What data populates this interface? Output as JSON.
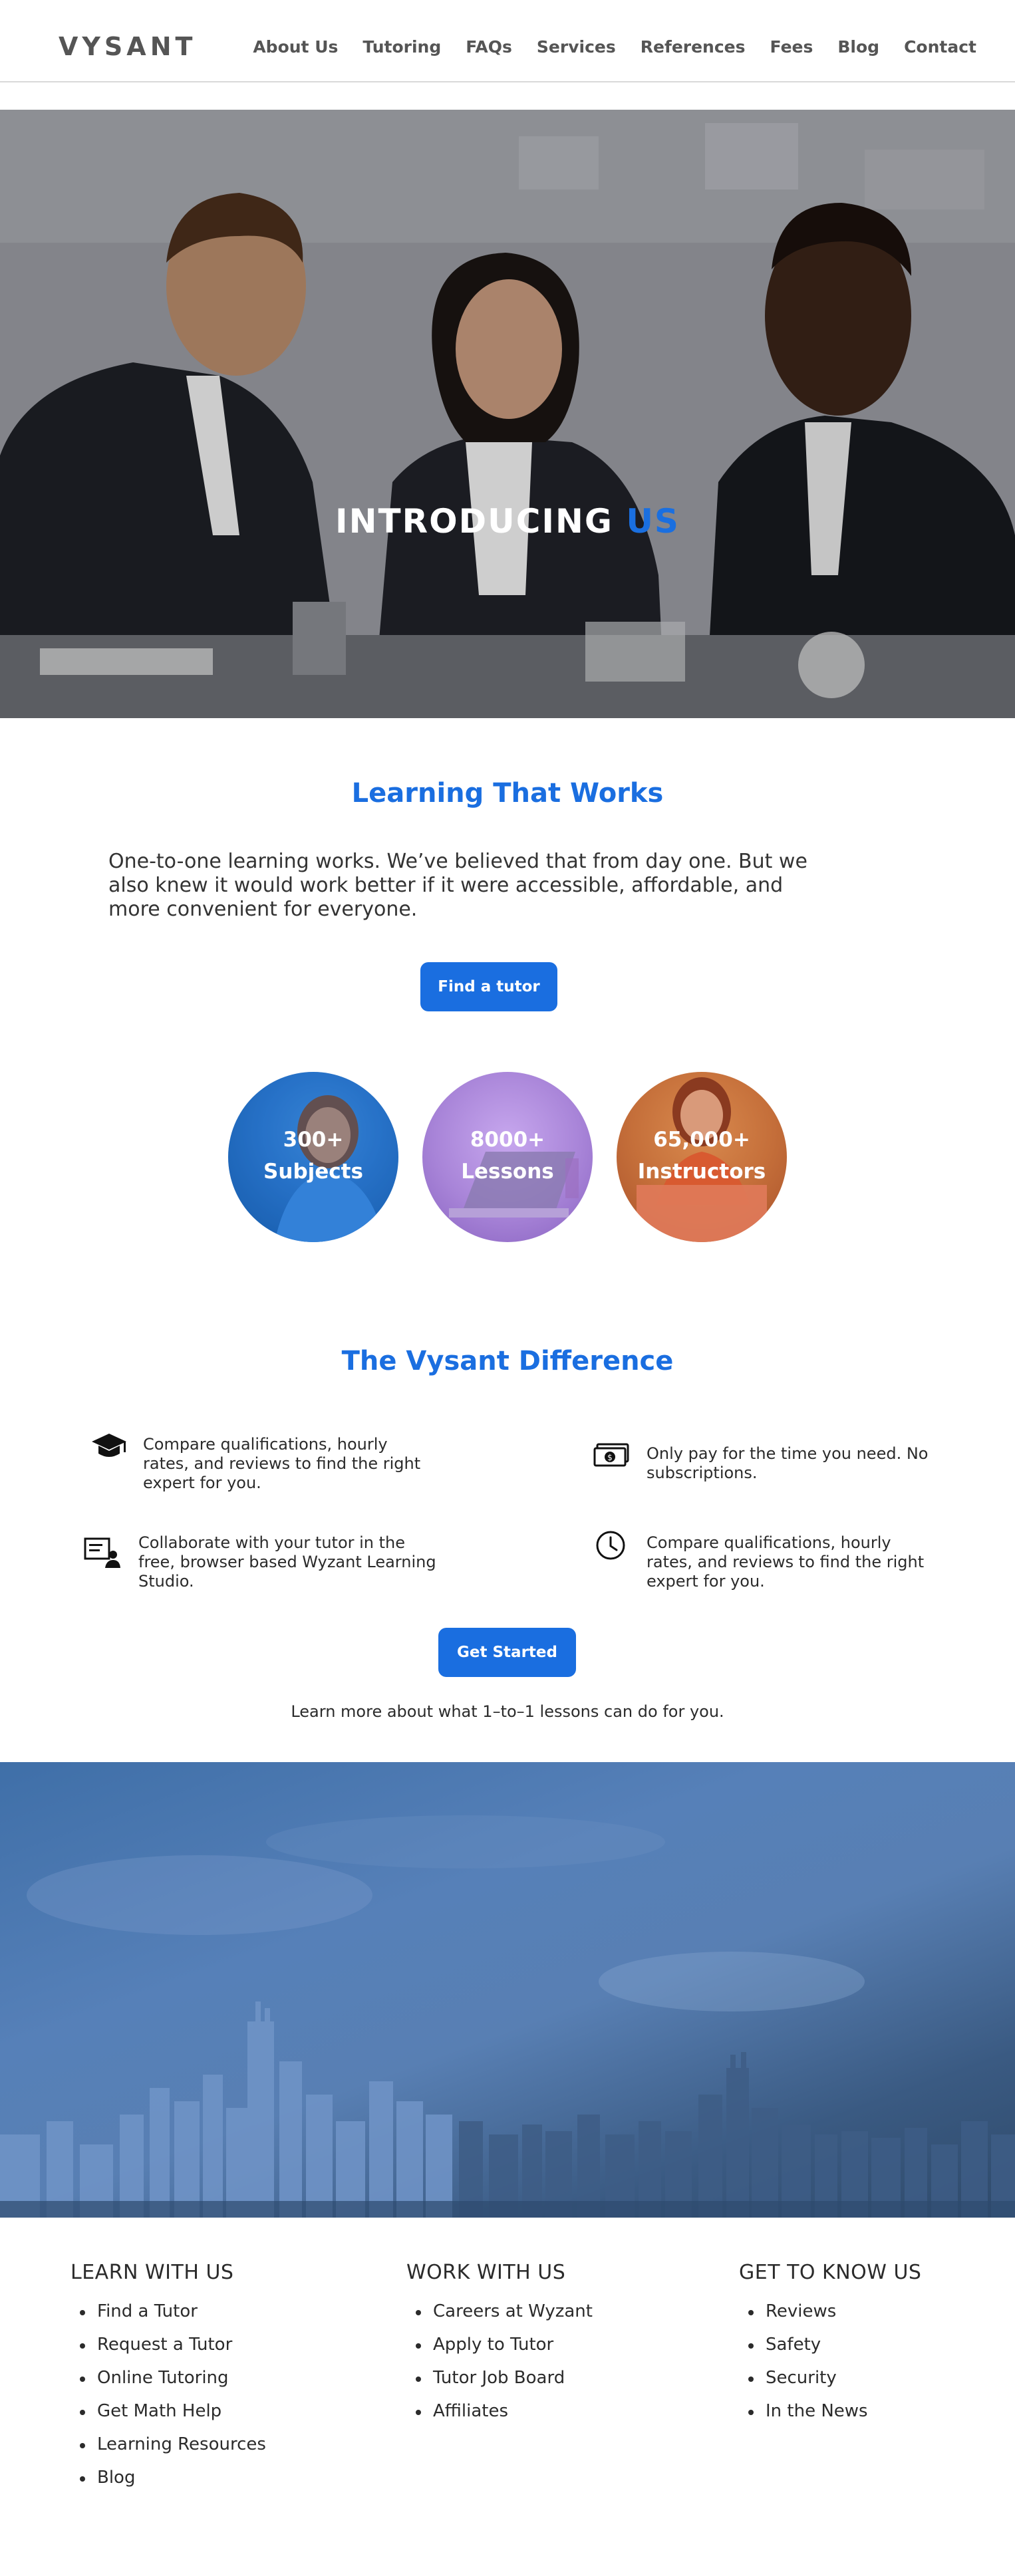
{
  "header": {
    "logo": "VYSANT",
    "nav": [
      "About Us",
      "Tutoring",
      "FAQs",
      "Services",
      "References",
      "Fees",
      "Blog",
      "Contact"
    ]
  },
  "hero": {
    "title_main": "INTRODUCING ",
    "title_accent": "US"
  },
  "learning": {
    "title": "Learning That Works",
    "text": "One-to-one learning works. We’ve believed that from day one. But we also knew it would work better if it were accessible, affordable, and more convenient for everyone.",
    "button": "Find a tutor"
  },
  "stats": [
    {
      "number": "300+",
      "label": "Subjects"
    },
    {
      "number": "8000+",
      "label": "Lessons"
    },
    {
      "number": "65,000+",
      "label": "Instructors"
    }
  ],
  "difference": {
    "title": "The Vysant Difference",
    "features": [
      {
        "icon": "graduation-cap-icon",
        "text": "Compare qualifications, hourly rates, and reviews to find the right expert for you."
      },
      {
        "icon": "money-bill-icon",
        "text": "Only pay for the time you need. No subscriptions."
      },
      {
        "icon": "teacher-board-icon",
        "text": "Collaborate with your tutor in the free, browser based Wyzant Learning Studio."
      },
      {
        "icon": "clock-icon",
        "text": "Compare qualifications, hourly rates, and reviews to find the right expert for you."
      }
    ],
    "button": "Get Started",
    "learn_more": "Learn more about what 1–to–1 lessons can do for you."
  },
  "footer": {
    "columns": [
      {
        "title": "LEARN WITH US",
        "items": [
          "Find a Tutor",
          "Request a Tutor",
          "Online Tutoring",
          "Get Math Help",
          "Learning Resources",
          "Blog"
        ]
      },
      {
        "title": "WORK WITH US",
        "items": [
          "Careers at Wyzant",
          "Apply to Tutor",
          "Tutor Job Board",
          "Affiliates"
        ]
      },
      {
        "title": "GET TO KNOW US",
        "items": [
          "Reviews",
          "Safety",
          "Security",
          "In the News"
        ]
      }
    ]
  },
  "colors": {
    "accent": "#1a6ee0",
    "text": "#2b2b2b",
    "nav": "#555555"
  }
}
